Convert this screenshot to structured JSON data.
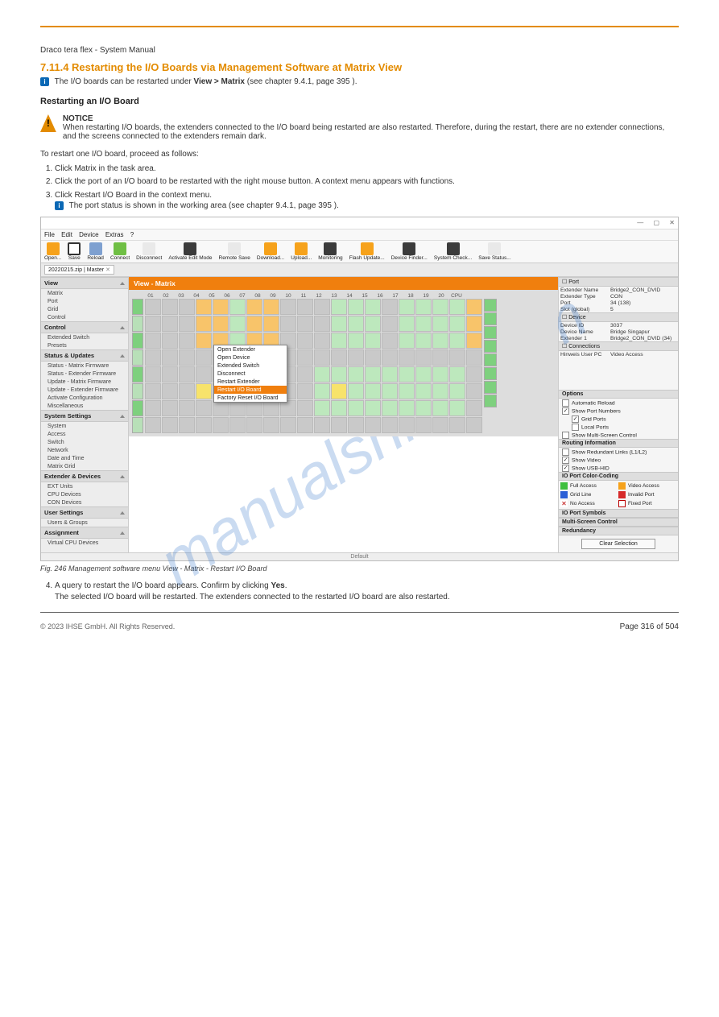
{
  "doc": {
    "title": "Draco tera flex - System Manual",
    "h2": "7.11.4 Restarting the I/O Boards via Management Software at Matrix View",
    "intro": "The I/O boards can be restarted under",
    "path": "View > Matrix",
    "h3": "Restarting an I/O Board",
    "note_head": "NOTICE",
    "note_body": "When restarting I/O boards, the extenders connected to the I/O board being restarted are also restarted. Therefore, during the restart, there are no extender connections, and the screens connected to the extenders remain dark.",
    "steps_lead": "To restart one I/O board, proceed as follows:",
    "steps": [
      "Click Matrix in the task area.",
      "Click the port of an I/O board to be restarted with the right mouse button. A context menu appears with functions.",
      "Click Restart I/O Board in the context menu."
    ],
    "tool_hint": "The port status is shown in the working area (see chapter 9.4.1, page 395 ).",
    "caption": "Fig. 246 Management software menu View - Matrix - Restart I/O Board",
    "step4_a": "A query to restart the I/O board appears. Confirm by clicking",
    "step4_b": "Yes",
    "step4_c": "The selected I/O board will be restarted. The extenders connected to the restarted I/O board are also restarted.",
    "copyright": "© 2023 IHSE GmbH. All Rights Reserved.",
    "pageno": "Page 316 of 504"
  },
  "app": {
    "menus": [
      "File",
      "Edit",
      "Device",
      "Extras",
      "?"
    ],
    "toolbar": [
      "Open...",
      "Save",
      "Reload",
      "Connect",
      "Disconnect",
      "Activate Edit Mode",
      "Remote Save",
      "Download...",
      "Upload...",
      "Monitoring",
      "Flash Update...",
      "Device Finder...",
      "System Check...",
      "Save Status..."
    ],
    "tab": "20220215.zip | Master",
    "viewTitle": "View - Matrix",
    "nav": {
      "View": [
        "Matrix",
        "Port",
        "Grid",
        "Control"
      ],
      "Control": [
        "Extended Switch",
        "Presets"
      ],
      "Status & Updates": [
        "Status - Matrix Firmware",
        "Status - Extender Firmware",
        "Update - Matrix Firmware",
        "Update - Extender Firmware",
        "Activate Configuration",
        "Miscellaneous"
      ],
      "System Settings": [
        "System",
        "Access",
        "Switch",
        "Network",
        "Date and Time",
        "Matrix Grid"
      ],
      "Extender & Devices": [
        "EXT Units",
        "CPU Devices",
        "CON Devices"
      ],
      "User Settings": [
        "Users & Groups"
      ],
      "Assignment": [
        "Virtual CPU Devices"
      ]
    },
    "cols": [
      "01",
      "02",
      "03",
      "04",
      "05",
      "06",
      "07",
      "08",
      "09",
      "10",
      "11",
      "12",
      "13",
      "14",
      "15",
      "16",
      "17",
      "18",
      "19",
      "20",
      "CPU"
    ],
    "ctx": [
      "Open Extender",
      "Open Device",
      "Extended Switch",
      "Disconnect",
      "Restart Extender",
      "Restart I/O Board",
      "Factory Reset I/O Board"
    ],
    "props": {
      "PortHdr": "Port",
      "Extender Name": "Bridge2_CON_DVID",
      "Extender Type": "CON",
      "Port": "34 (138)",
      "Slot (global)": "5",
      "DeviceHdr": "Device",
      "Device ID": "3037",
      "Device Name": "Bridge Singapur",
      "Extender 1": "Bridge2_CON_DVID (34)",
      "ConnHdr": "Connections",
      "Hinweis User PC": "Video Access"
    },
    "optionsHdr": "Options",
    "opts": [
      "Automatic Reload",
      "Show Port Numbers",
      "Grid Ports",
      "Local Ports",
      "Show Multi-Screen Control"
    ],
    "routeHdr": "Routing Information",
    "route": [
      "Show Redundant Links (L1/L2)",
      "Show Video",
      "Show USB-HID"
    ],
    "legHdr": "IO Port Color-Coding",
    "legend": [
      [
        "green",
        "Full Access"
      ],
      [
        "orange",
        "Video Access"
      ],
      [
        "blue",
        "Grid Line"
      ],
      [
        "red",
        "Invalid Port"
      ],
      [
        "redx",
        "No Access"
      ],
      [
        "box",
        "Fixed Port"
      ]
    ],
    "sectHdrs": [
      "IO Port Symbols",
      "Multi-Screen Control",
      "Redundancy"
    ],
    "clear": "Clear Selection",
    "status": "Default"
  },
  "wm": "manualshive.com"
}
